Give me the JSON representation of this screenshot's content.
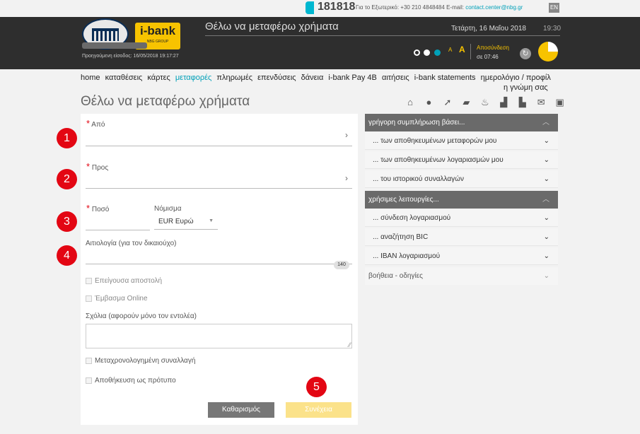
{
  "top": {
    "hotline": "181818",
    "abroad_label": "Για το Εξωτερικό: +30 210 4848484",
    "email_label": "E-mail:",
    "email": "contact.center@nbg.gr",
    "lang": "EN"
  },
  "header": {
    "ibank_logo": "i-bank",
    "ibank_sub": "NBG GROUP",
    "title": "Θέλω να μεταφέρω χρήματα",
    "date": "Τετάρτη, 16 Μαΐου 2018",
    "time": "19:30",
    "prev_login": "Προηγούμενη είσοδος: 16/05/2018 19:17:27",
    "font_small": "A",
    "font_large": "A",
    "logout": "Αποσύνδεση",
    "logout_time": "σε 07:46"
  },
  "menu": {
    "items": [
      "home",
      "καταθέσεις",
      "κάρτες",
      "μεταφορές",
      "πληρωμές",
      "επενδύσεις",
      "δάνεια",
      "i-bank Pay 4B",
      "αιτήσεις",
      "i-bank statements",
      "ημερολόγιο / προφίλ"
    ],
    "continuation": "η γνώμη σας",
    "active_index": 3
  },
  "page": {
    "title": "Θέλω να μεταφέρω χρήματα"
  },
  "form": {
    "req_mark": "*",
    "from_label": "Από",
    "to_label": "Προς",
    "amount_label": "Ποσό",
    "currency_label": "Νόμισμα",
    "currency_value": "EUR Ευρώ",
    "reason_label": "Αιτιολογία (για τον δικαιούχο)",
    "counter": "140",
    "urgent_label": "Επείγουσα αποστολή",
    "online_label": "Έμβασμα Online",
    "comments_label": "Σχόλια (αφορούν μόνο τον εντολέα)",
    "postdated_label": "Μεταχρονολογημένη συναλλαγή",
    "save_template_label": "Αποθήκευση ως πρότυπο",
    "clear_button": "Καθαρισμός",
    "continue_button": "Συνέχεια",
    "chevron": "›"
  },
  "markers": [
    "1",
    "2",
    "3",
    "4",
    "5"
  ],
  "sidebar": {
    "group1": "γρήγορη συμπλήρωση βάσει...",
    "group1_items": [
      "... των αποθηκευμένων μεταφορών μου",
      "... των αποθηκευμένων λογαριασμών μου",
      "... του ιστορικού συναλλαγών"
    ],
    "group2": "χρήσιμες λειτουργίες...",
    "group2_items": [
      "... σύνδεση λογαριασμού",
      "... αναζήτηση BIC",
      "... IBAN λογαριασμού"
    ],
    "help": "βοήθεια - οδηγίες",
    "chev_up": "︿",
    "chev_down": "⌄"
  },
  "colors": {
    "accent": "#00a0b8",
    "brand_yellow": "#f7c300",
    "header_bg": "#2e2e2e",
    "marker_red": "#e30613"
  }
}
